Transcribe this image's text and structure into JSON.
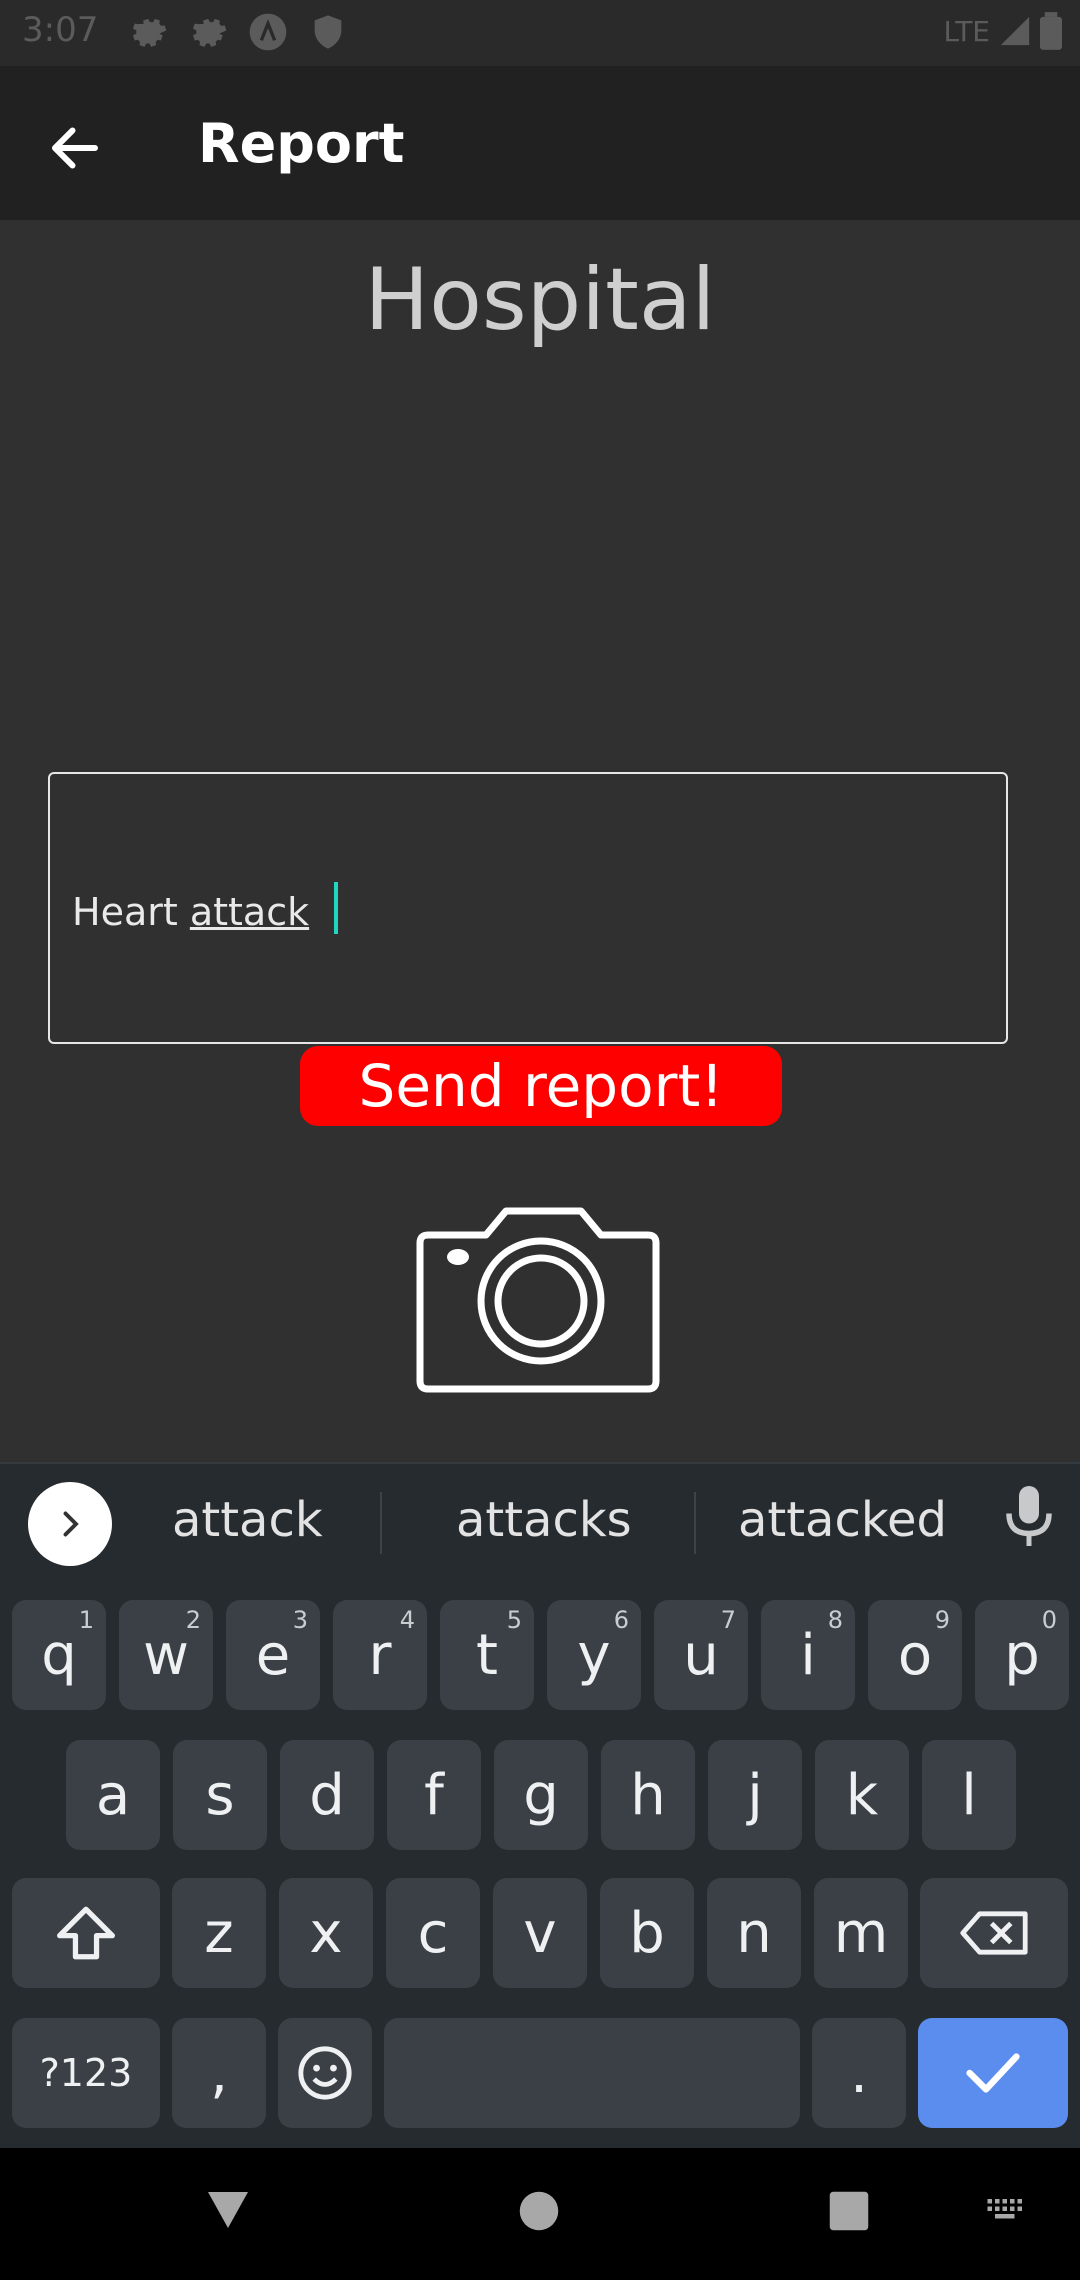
{
  "status": {
    "time": "3:07",
    "network": "LTE",
    "icons": [
      "gear-icon",
      "gear-icon",
      "a-icon",
      "shield-icon"
    ]
  },
  "appbar": {
    "title": "Report"
  },
  "main": {
    "heading": "Hospital",
    "report_value_word1": "Heart ",
    "report_value_word2": "attack",
    "send_label": "Send report!"
  },
  "keyboard": {
    "suggestions": [
      "attack",
      "attacks",
      "attacked"
    ],
    "row1": [
      {
        "l": "q",
        "n": "1"
      },
      {
        "l": "w",
        "n": "2"
      },
      {
        "l": "e",
        "n": "3"
      },
      {
        "l": "r",
        "n": "4"
      },
      {
        "l": "t",
        "n": "5"
      },
      {
        "l": "y",
        "n": "6"
      },
      {
        "l": "u",
        "n": "7"
      },
      {
        "l": "i",
        "n": "8"
      },
      {
        "l": "o",
        "n": "9"
      },
      {
        "l": "p",
        "n": "0"
      }
    ],
    "row2": [
      "a",
      "s",
      "d",
      "f",
      "g",
      "h",
      "j",
      "k",
      "l"
    ],
    "row3": [
      "z",
      "x",
      "c",
      "v",
      "b",
      "n",
      "m"
    ],
    "symbols_label": "?123",
    "comma_label": ",",
    "period_label": ".",
    "enter_color": "#5b8def"
  },
  "colors": {
    "send_button": "#ff0000",
    "caret": "#1fd6c1"
  }
}
